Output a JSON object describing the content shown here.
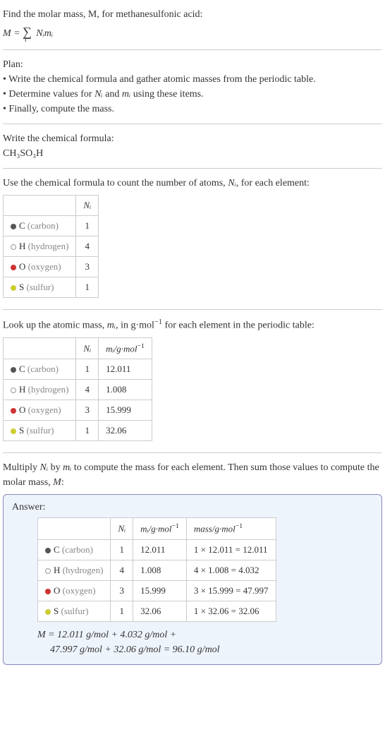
{
  "intro": {
    "line1": "Find the molar mass, M, for methanesulfonic acid:",
    "formula_prefix": "M = ",
    "formula_sigma": "∑",
    "formula_sub_i": "i",
    "formula_body": " Nᵢmᵢ"
  },
  "plan": {
    "title": "Plan:",
    "item1": "• Write the chemical formula and gather atomic masses from the periodic table.",
    "item2_pre": "• Determine values for ",
    "item2_ni": "Nᵢ",
    "item2_mid": " and ",
    "item2_mi": "mᵢ",
    "item2_post": " using these items.",
    "item3": "• Finally, compute the mass."
  },
  "chem_formula": {
    "title": "Write the chemical formula:",
    "formula": "CH₃SO₃H"
  },
  "count": {
    "title_pre": "Use the chemical formula to count the number of atoms, ",
    "title_ni": "Nᵢ",
    "title_post": ", for each element:",
    "header_ni": "Nᵢ",
    "rows": [
      {
        "dot": "dot-c",
        "symbol": "C",
        "name": " (carbon)",
        "ni": "1"
      },
      {
        "dot": "dot-h",
        "symbol": "H",
        "name": " (hydrogen)",
        "ni": "4"
      },
      {
        "dot": "dot-o",
        "symbol": "O",
        "name": " (oxygen)",
        "ni": "3"
      },
      {
        "dot": "dot-s",
        "symbol": "S",
        "name": " (sulfur)",
        "ni": "1"
      }
    ]
  },
  "lookup": {
    "title_pre": "Look up the atomic mass, ",
    "title_mi": "mᵢ",
    "title_mid": ", in g·mol",
    "title_sup": "−1",
    "title_post": " for each element in the periodic table:",
    "header_ni": "Nᵢ",
    "header_mi_pre": "mᵢ/g·mol",
    "header_mi_sup": "−1",
    "rows": [
      {
        "dot": "dot-c",
        "symbol": "C",
        "name": " (carbon)",
        "ni": "1",
        "mi": "12.011"
      },
      {
        "dot": "dot-h",
        "symbol": "H",
        "name": " (hydrogen)",
        "ni": "4",
        "mi": "1.008"
      },
      {
        "dot": "dot-o",
        "symbol": "O",
        "name": " (oxygen)",
        "ni": "3",
        "mi": "15.999"
      },
      {
        "dot": "dot-s",
        "symbol": "S",
        "name": " (sulfur)",
        "ni": "1",
        "mi": "32.06"
      }
    ]
  },
  "multiply": {
    "text_pre": "Multiply ",
    "text_ni": "Nᵢ",
    "text_mid1": " by ",
    "text_mi": "mᵢ",
    "text_mid2": " to compute the mass for each element. Then sum those values to compute the molar mass, ",
    "text_M": "M",
    "text_post": ":"
  },
  "answer": {
    "title": "Answer:",
    "header_ni": "Nᵢ",
    "header_mi_pre": "mᵢ/g·mol",
    "header_mi_sup": "−1",
    "header_mass_pre": "mass/g·mol",
    "header_mass_sup": "−1",
    "rows": [
      {
        "dot": "dot-c",
        "symbol": "C",
        "name": " (carbon)",
        "ni": "1",
        "mi": "12.011",
        "mass": "1 × 12.011 = 12.011"
      },
      {
        "dot": "dot-h",
        "symbol": "H",
        "name": " (hydrogen)",
        "ni": "4",
        "mi": "1.008",
        "mass": "4 × 1.008 = 4.032"
      },
      {
        "dot": "dot-o",
        "symbol": "O",
        "name": " (oxygen)",
        "ni": "3",
        "mi": "15.999",
        "mass": "3 × 15.999 = 47.997"
      },
      {
        "dot": "dot-s",
        "symbol": "S",
        "name": " (sulfur)",
        "ni": "1",
        "mi": "32.06",
        "mass": "1 × 32.06 = 32.06"
      }
    ],
    "eqn_line1": "M = 12.011 g/mol + 4.032 g/mol +",
    "eqn_line2": "47.997 g/mol + 32.06 g/mol = 96.10 g/mol"
  }
}
